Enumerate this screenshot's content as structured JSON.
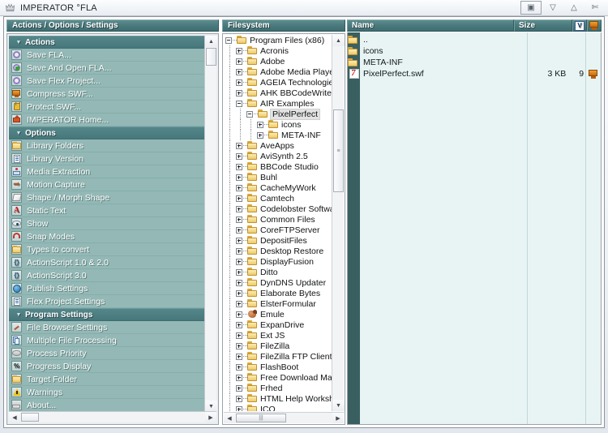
{
  "window": {
    "title": "IMPERATOR °FLA",
    "app_icon": "crown-icon",
    "buttons": [
      {
        "name": "restore-button",
        "glyph": "▣"
      },
      {
        "name": "minimize-button",
        "glyph": "▽"
      },
      {
        "name": "maximize-button",
        "glyph": "△"
      },
      {
        "name": "close-button",
        "glyph": "✄"
      }
    ]
  },
  "left_panel": {
    "header": "Actions / Options / Settings",
    "groups": [
      {
        "label": "Actions",
        "name": "group-actions",
        "arrow": "▼",
        "items": [
          {
            "label": "Save FLA...",
            "icon": "purple-disc-icon",
            "glyph": "g-circle"
          },
          {
            "label": "Save And Open FLA...",
            "icon": "purple-disc-green-icon",
            "glyph": "g-circle green"
          },
          {
            "label": "Save Flex Project...",
            "icon": "purple-disc-dark-icon",
            "glyph": "g-circle"
          },
          {
            "label": "Compress SWF...",
            "icon": "monitor-icon",
            "glyph": "g-monitor"
          },
          {
            "label": "Protect SWF...",
            "icon": "lock-icon",
            "glyph": "g-lock"
          },
          {
            "label": "IMPERATOR Home...",
            "icon": "home-icon",
            "glyph": "g-home"
          }
        ]
      },
      {
        "label": "Options",
        "name": "group-options",
        "arrow": "▼",
        "items": [
          {
            "label": "Library Folders",
            "icon": "folder-icon",
            "glyph": "g-folder"
          },
          {
            "label": "Library Version",
            "icon": "document-icon",
            "glyph": "g-doc"
          },
          {
            "label": "Media Extraction",
            "icon": "media-icon",
            "glyph": "g-media"
          },
          {
            "label": "Motion Capture",
            "icon": "arrow-right-icon",
            "glyph": "g-arrow",
            "text": "➡"
          },
          {
            "label": "Shape / Morph Shape",
            "icon": "shape-icon",
            "glyph": "g-shape"
          },
          {
            "label": "Static Text",
            "icon": "text-a-icon",
            "glyph": "g-A",
            "text": "A"
          },
          {
            "label": "Show",
            "icon": "eye-icon",
            "glyph": "g-eye"
          },
          {
            "label": "Snap Modes",
            "icon": "magnet-icon",
            "glyph": "g-magnet"
          },
          {
            "label": "Types to convert",
            "icon": "folder-convert-icon",
            "glyph": "g-folder"
          },
          {
            "label": "ActionScript 1.0 & 2.0",
            "icon": "braces-icon",
            "glyph": "g-brace",
            "text": "{}"
          },
          {
            "label": "ActionScript 3.0",
            "icon": "braces-icon",
            "glyph": "g-brace",
            "text": "{}"
          },
          {
            "label": "Publish Settings",
            "icon": "globe-icon",
            "glyph": "g-globe"
          },
          {
            "label": "Flex Project Settings",
            "icon": "code-doc-icon",
            "glyph": "g-doc"
          }
        ]
      },
      {
        "label": "Program Settings",
        "name": "group-program-settings",
        "arrow": "▼",
        "items": [
          {
            "label": "File Browser Settings",
            "icon": "pencil-icon",
            "glyph": "g-pencil"
          },
          {
            "label": "Multiple File Processing",
            "icon": "copy-icon",
            "glyph": "g-copy"
          },
          {
            "label": "Process Priority",
            "icon": "disc-icon",
            "glyph": "g-disc"
          },
          {
            "label": "Progress Display",
            "icon": "percent-icon",
            "glyph": "g-pct",
            "text": "%"
          },
          {
            "label": "Target Folder",
            "icon": "folder-target-icon",
            "glyph": "g-folder"
          },
          {
            "label": "Warnings",
            "icon": "warning-icon",
            "glyph": "g-warn"
          },
          {
            "label": "About...",
            "icon": "crown-icon",
            "glyph": "g-crown"
          }
        ]
      }
    ],
    "scroll": {
      "up": "▲",
      "down": "▼",
      "left": "◀",
      "right": "▶"
    }
  },
  "mid_panel": {
    "header": "Filesystem",
    "scroll": {
      "up": "▲",
      "down": "▼",
      "left": "◀",
      "right": "▶"
    },
    "tree": [
      {
        "label": "Program Files (x86)",
        "depth": 0,
        "state": "minus",
        "selected": false
      },
      {
        "label": "Acronis",
        "depth": 1,
        "state": "plus",
        "selected": false
      },
      {
        "label": "Adobe",
        "depth": 1,
        "state": "plus",
        "selected": false
      },
      {
        "label": "Adobe Media Player",
        "depth": 1,
        "state": "plus",
        "selected": false
      },
      {
        "label": "AGEIA Technologies",
        "depth": 1,
        "state": "plus",
        "selected": false
      },
      {
        "label": "AHK BBCodeWriter",
        "depth": 1,
        "state": "plus",
        "selected": false
      },
      {
        "label": "AIR Examples",
        "depth": 1,
        "state": "minus",
        "selected": false
      },
      {
        "label": "PixelPerfect",
        "depth": 2,
        "state": "minus",
        "selected": true
      },
      {
        "label": "icons",
        "depth": 3,
        "state": "plus",
        "selected": false
      },
      {
        "label": "META-INF",
        "depth": 3,
        "state": "plus",
        "selected": false
      },
      {
        "label": "AveApps",
        "depth": 1,
        "state": "plus",
        "selected": false
      },
      {
        "label": "AviSynth 2.5",
        "depth": 1,
        "state": "plus",
        "selected": false
      },
      {
        "label": "BBCode Studio",
        "depth": 1,
        "state": "plus",
        "selected": false
      },
      {
        "label": "Buhl",
        "depth": 1,
        "state": "plus",
        "selected": false
      },
      {
        "label": "CacheMyWork",
        "depth": 1,
        "state": "plus",
        "selected": false
      },
      {
        "label": "Camtech",
        "depth": 1,
        "state": "plus",
        "selected": false
      },
      {
        "label": "Codelobster Software",
        "depth": 1,
        "state": "plus",
        "selected": false
      },
      {
        "label": "Common Files",
        "depth": 1,
        "state": "plus",
        "selected": false
      },
      {
        "label": "CoreFTPServer",
        "depth": 1,
        "state": "plus",
        "selected": false
      },
      {
        "label": "DepositFiles",
        "depth": 1,
        "state": "plus",
        "selected": false
      },
      {
        "label": "Desktop Restore",
        "depth": 1,
        "state": "plus",
        "selected": false
      },
      {
        "label": "DisplayFusion",
        "depth": 1,
        "state": "plus",
        "selected": false
      },
      {
        "label": "Ditto",
        "depth": 1,
        "state": "plus",
        "selected": false
      },
      {
        "label": "DynDNS Updater",
        "depth": 1,
        "state": "plus",
        "selected": false
      },
      {
        "label": "Elaborate Bytes",
        "depth": 1,
        "state": "plus",
        "selected": false
      },
      {
        "label": "ElsterFormular",
        "depth": 1,
        "state": "plus",
        "selected": false
      },
      {
        "label": "Emule",
        "depth": 1,
        "state": "plus",
        "selected": false,
        "icon": "emule-icon"
      },
      {
        "label": "ExpanDrive",
        "depth": 1,
        "state": "plus",
        "selected": false
      },
      {
        "label": "Ext JS",
        "depth": 1,
        "state": "plus",
        "selected": false
      },
      {
        "label": "FileZilla",
        "depth": 1,
        "state": "plus",
        "selected": false
      },
      {
        "label": "FileZilla FTP Client",
        "depth": 1,
        "state": "plus",
        "selected": false
      },
      {
        "label": "FlashBoot",
        "depth": 1,
        "state": "plus",
        "selected": false
      },
      {
        "label": "Free Download Manager",
        "depth": 1,
        "state": "plus",
        "selected": false
      },
      {
        "label": "Frhed",
        "depth": 1,
        "state": "plus",
        "selected": false
      },
      {
        "label": "HTML Help Workshop",
        "depth": 1,
        "state": "plus",
        "selected": false
      },
      {
        "label": "ICQ...",
        "depth": 1,
        "state": "plus",
        "selected": false
      }
    ]
  },
  "right_panel": {
    "columns": [
      {
        "label": "Name",
        "name": "column-name"
      },
      {
        "label": "Size",
        "name": "column-size"
      },
      {
        "label": "V",
        "name": "column-version-flag"
      },
      {
        "label": "",
        "name": "column-swf-icon"
      }
    ],
    "rows": [
      {
        "name": "..",
        "size": "",
        "flag": "",
        "icon": "folder-icon",
        "swf": false
      },
      {
        "name": "icons",
        "size": "",
        "flag": "",
        "icon": "folder-icon",
        "swf": false
      },
      {
        "name": "META-INF",
        "size": "",
        "flag": "",
        "icon": "folder-icon",
        "swf": false
      },
      {
        "name": "PixelPerfect.swf",
        "size": "3 KB",
        "flag": "9",
        "icon": "flash-icon",
        "swf": true
      }
    ]
  }
}
